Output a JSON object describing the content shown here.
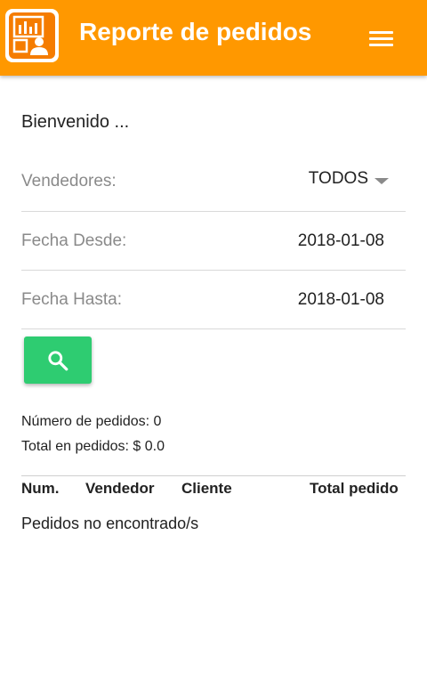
{
  "appbar": {
    "title": "Reporte de pedidos",
    "logo_icon": "orders-report-logo-icon",
    "menu_icon": "hamburger-menu-icon",
    "color": "#ff9800"
  },
  "welcome": "Bienvenido ...",
  "filters": {
    "vendedores_label": "Vendedores:",
    "vendedores_value": "TODOS",
    "fecha_desde_label": "Fecha Desde:",
    "fecha_desde_value": "2018-01-08",
    "fecha_hasta_label": "Fecha Hasta:",
    "fecha_hasta_value": "2018-01-08"
  },
  "search_button": {
    "icon": "search-icon",
    "color": "#2ecc71"
  },
  "summary": {
    "count": "Número de pedidos: 0",
    "total": "Total en pedidos: $ 0.0"
  },
  "table": {
    "headers": [
      "Num.",
      "Vendedor",
      "Cliente",
      "Total pedido"
    ],
    "empty_message": "Pedidos no encontrado/s"
  }
}
